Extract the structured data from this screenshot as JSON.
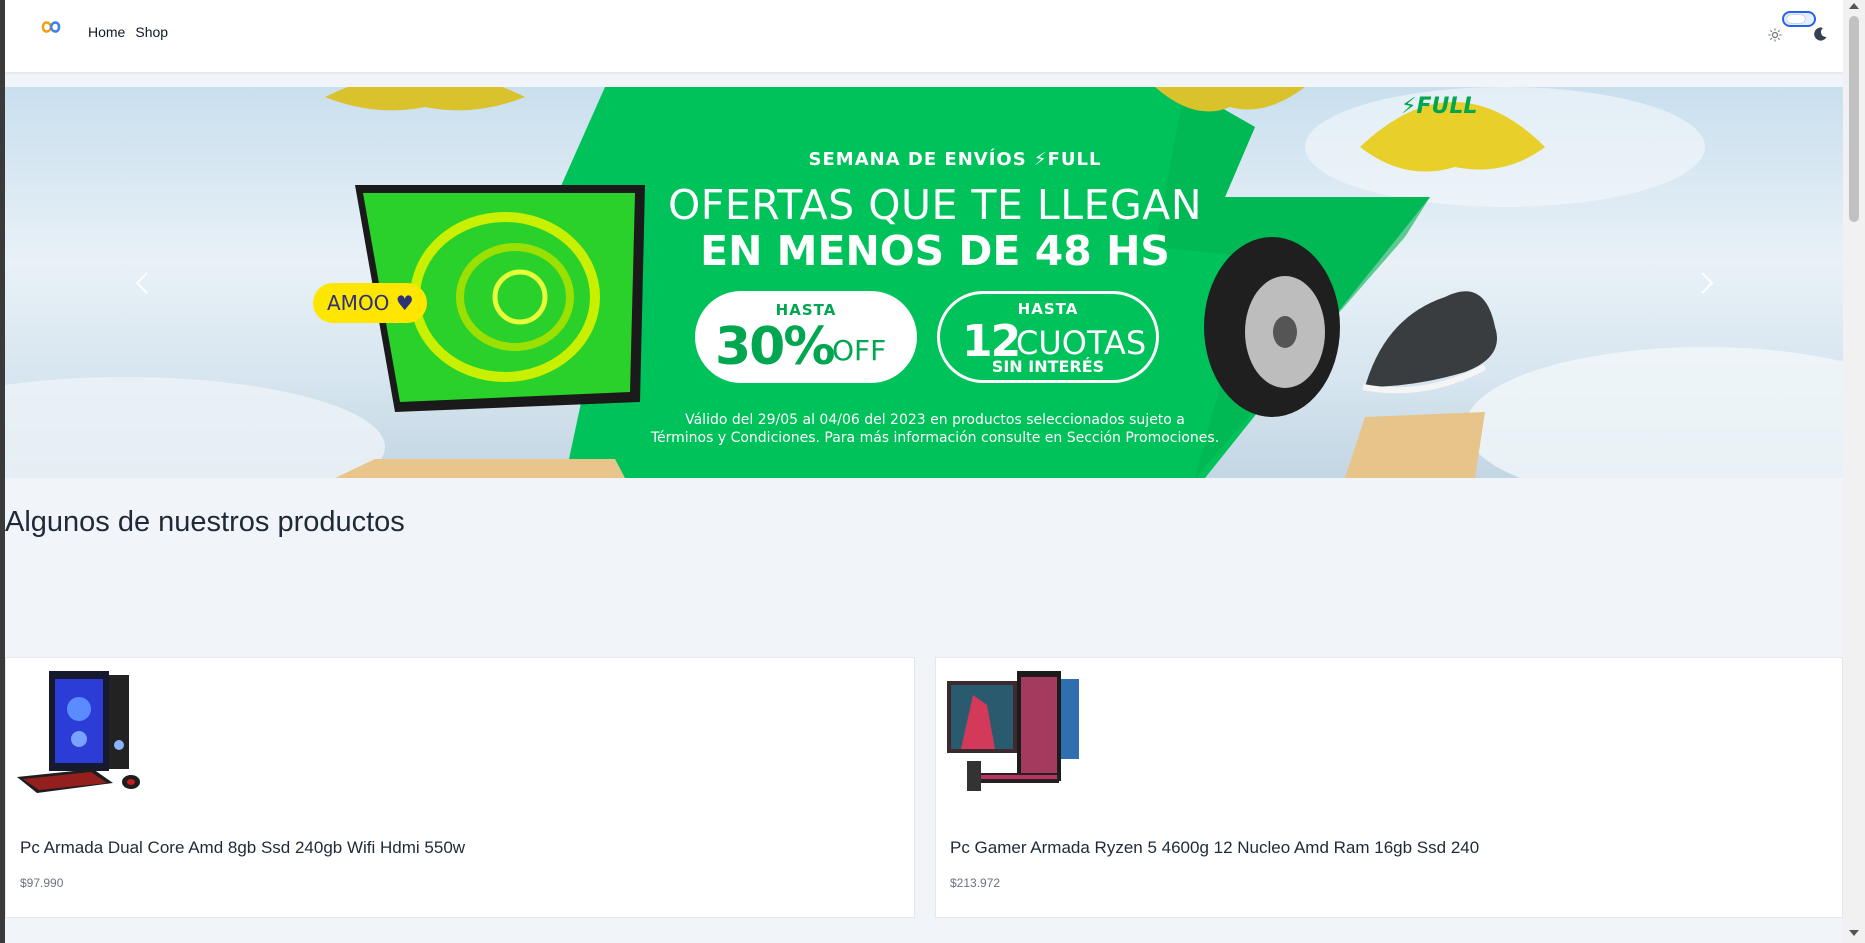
{
  "nav": {
    "logo_icon": "infinity-logo-icon",
    "links": [
      "Home",
      "Shop"
    ]
  },
  "theme_switch": {
    "sun_icon": "sun-icon",
    "moon_icon": "moon-icon",
    "accent": "#2563eb"
  },
  "hero": {
    "kicker": "SEMANA DE ENVÍOS ⚡FULL",
    "headline_line1": "OFERTAS QUE TE LLEGAN",
    "headline_line2": "EN MENOS DE 48 HS",
    "offer1_hasta": "HASTA",
    "offer1_value": "30%",
    "offer1_suffix": "OFF",
    "offer2_hasta": "HASTA",
    "offer2_value": "12",
    "offer2_suffix": "CUOTAS",
    "offer2_note": "SIN INTERÉS",
    "legal_line1": "Válido del 29/05 al 04/06 del 2023 en productos seleccionados sujeto a",
    "legal_line2": "Términos y Condiciones. Para más información consulte en Sección Promociones.",
    "amoo_badge": "AMOO",
    "parachute_badge": "⚡FULL",
    "brand_green": "#00a650",
    "brand_yellow": "#ffe600"
  },
  "section": {
    "title": "Algunos de nuestros productos"
  },
  "products": [
    {
      "title": "Pc Armada Dual Core Amd 8gb Ssd 240gb Wifi Hdmi 550w",
      "price": "$97.990"
    },
    {
      "title": "Pc Gamer Armada Ryzen 5 4600g 12 Nucleo Amd Ram 16gb Ssd 240",
      "price": "$213.972"
    }
  ]
}
